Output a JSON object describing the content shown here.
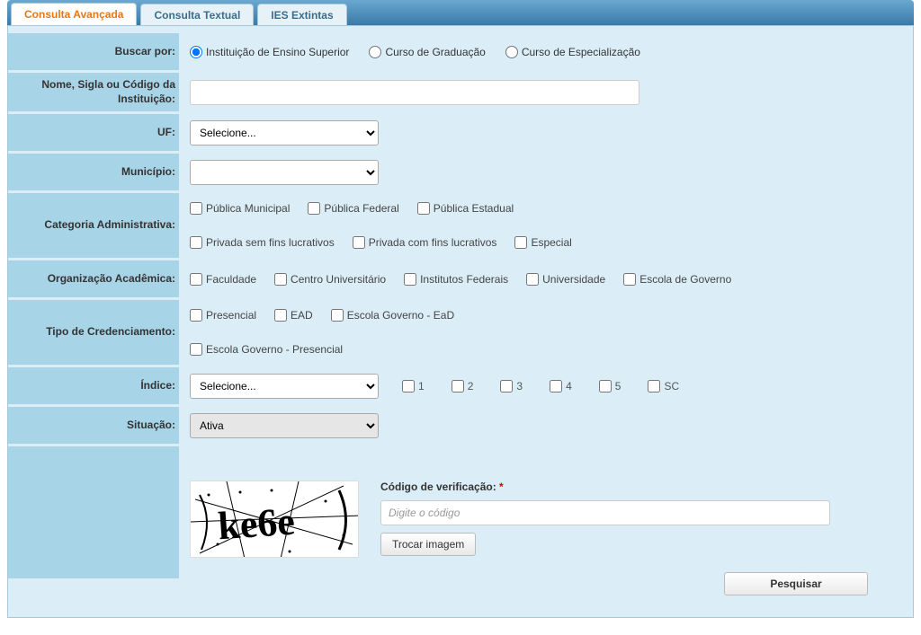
{
  "tabs": [
    {
      "label": "Consulta Avançada",
      "active": true
    },
    {
      "label": "Consulta Textual",
      "active": false
    },
    {
      "label": "IES Extintas",
      "active": false
    }
  ],
  "labels": {
    "buscar_por": "Buscar por:",
    "nome": "Nome, Sigla ou Código da Instituição:",
    "uf": "UF:",
    "municipio": "Município:",
    "categoria": "Categoria Administrativa:",
    "organizacao": "Organização Acadêmica:",
    "tipo_cred": "Tipo de Credenciamento:",
    "indice": "Índice:",
    "situacao": "Situação:"
  },
  "buscar_por_options": [
    {
      "label": "Instituição de Ensino Superior",
      "checked": true
    },
    {
      "label": "Curso de Graduação",
      "checked": false
    },
    {
      "label": "Curso de Especialização",
      "checked": false
    }
  ],
  "nome_value": "",
  "uf_selecione": "Selecione...",
  "municipio_value": "",
  "categoria_options": [
    "Pública Municipal",
    "Pública Federal",
    "Pública Estadual",
    "Privada sem fins lucrativos",
    "Privada com fins lucrativos",
    "Especial"
  ],
  "organizacao_options": [
    "Faculdade",
    "Centro Universitário",
    "Institutos Federais",
    "Universidade",
    "Escola de Governo"
  ],
  "tipo_cred_options": [
    "Presencial",
    "EAD",
    "Escola Governo - EaD",
    "Escola Governo - Presencial"
  ],
  "indice_selecione": "Selecione...",
  "indice_checks": [
    "1",
    "2",
    "3",
    "4",
    "5",
    "SC"
  ],
  "situacao_value": "Ativa",
  "captcha_text": "ke6e",
  "verif_label": "Código de verificação:",
  "verif_placeholder": "Digite o código",
  "trocar_label": "Trocar imagem",
  "pesquisar_label": "Pesquisar"
}
